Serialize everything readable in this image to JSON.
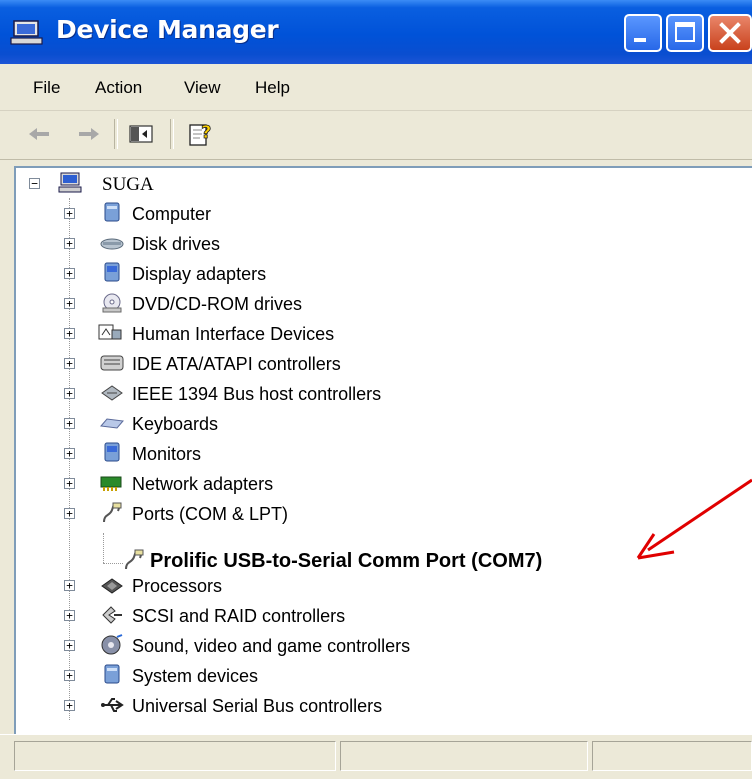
{
  "window": {
    "title": "Device Manager",
    "accent": "#0a5fe0",
    "close_color": "#c9421d"
  },
  "menubar": {
    "items": [
      "File",
      "Action",
      "View",
      "Help"
    ]
  },
  "toolbar": {
    "buttons": [
      "back-arrow-icon",
      "forward-arrow-icon",
      "show-hide-console-tree-icon",
      "help-icon"
    ]
  },
  "tree": {
    "root": {
      "label": "SUGA",
      "icon": "computer-icon"
    },
    "items": [
      {
        "label": "Computer",
        "icon": "computer-icon"
      },
      {
        "label": "Disk drives",
        "icon": "disk-drive-icon"
      },
      {
        "label": "Display adapters",
        "icon": "display-adapter-icon"
      },
      {
        "label": "DVD/CD-ROM drives",
        "icon": "cdrom-icon"
      },
      {
        "label": "Human Interface Devices",
        "icon": "hid-icon"
      },
      {
        "label": "IDE ATA/ATAPI controllers",
        "icon": "ide-controller-icon"
      },
      {
        "label": "IEEE 1394 Bus host controllers",
        "icon": "firewire-icon"
      },
      {
        "label": "Keyboards",
        "icon": "keyboard-icon"
      },
      {
        "label": "Monitors",
        "icon": "monitor-icon"
      },
      {
        "label": "Network adapters",
        "icon": "network-adapter-icon"
      },
      {
        "label": "Ports (COM & LPT)",
        "icon": "port-icon",
        "expanded": true,
        "children": [
          {
            "label": "Prolific USB-to-Serial Comm Port (COM7)",
            "icon": "port-icon"
          }
        ]
      },
      {
        "label": "Processors",
        "icon": "processor-icon"
      },
      {
        "label": "SCSI and RAID controllers",
        "icon": "scsi-icon"
      },
      {
        "label": "Sound, video and game controllers",
        "icon": "sound-icon"
      },
      {
        "label": "System devices",
        "icon": "system-device-icon"
      },
      {
        "label": "Universal Serial Bus controllers",
        "icon": "usb-icon"
      }
    ]
  },
  "annotation": {
    "color": "#e00000",
    "icon": "red-arrow-icon"
  }
}
